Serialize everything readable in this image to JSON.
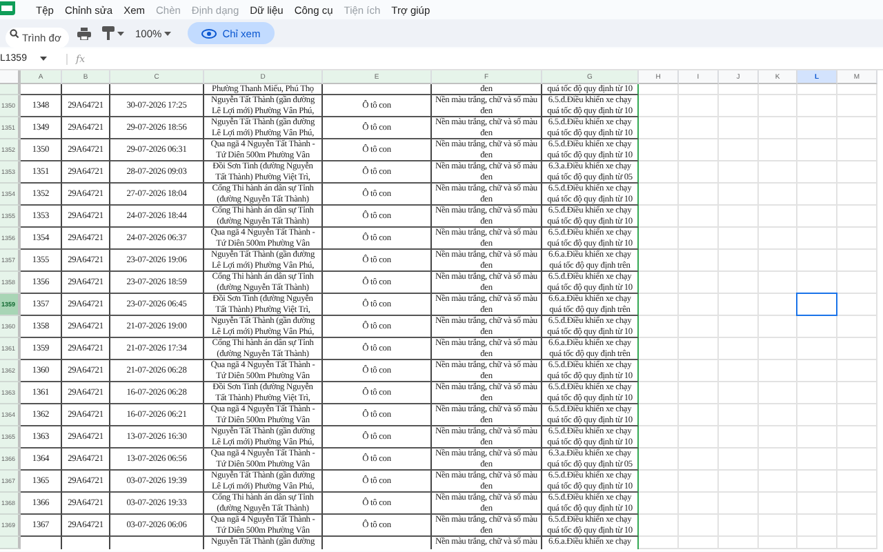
{
  "menu": [
    {
      "label": "Tệp",
      "disabled": false
    },
    {
      "label": "Chỉnh sửa",
      "disabled": false
    },
    {
      "label": "Xem",
      "disabled": false
    },
    {
      "label": "Chèn",
      "disabled": true
    },
    {
      "label": "Định dạng",
      "disabled": true
    },
    {
      "label": "Dữ liệu",
      "disabled": false
    },
    {
      "label": "Công cụ",
      "disabled": false
    },
    {
      "label": "Tiện ích",
      "disabled": true
    },
    {
      "label": "Trợ giúp",
      "disabled": false
    }
  ],
  "toolbar": {
    "search": {
      "placeholder": "Trình đơ"
    },
    "zoom": "100%",
    "view_mode": "Chỉ xem"
  },
  "formula_bar": {
    "name_box": "L1359",
    "fx": "fx"
  },
  "columns": [
    {
      "label": "A",
      "tinted": true,
      "selected": false
    },
    {
      "label": "B",
      "tinted": true,
      "selected": false
    },
    {
      "label": "C",
      "tinted": true,
      "selected": false
    },
    {
      "label": "D",
      "tinted": true,
      "selected": false
    },
    {
      "label": "E",
      "tinted": true,
      "selected": false
    },
    {
      "label": "F",
      "tinted": true,
      "selected": false
    },
    {
      "label": "G",
      "tinted": true,
      "selected": false
    },
    {
      "label": "H",
      "tinted": false,
      "selected": false
    },
    {
      "label": "I",
      "tinted": false,
      "selected": false
    },
    {
      "label": "J",
      "tinted": false,
      "selected": false
    },
    {
      "label": "K",
      "tinted": false,
      "selected": false
    },
    {
      "label": "L",
      "tinted": false,
      "selected": true
    },
    {
      "label": "M",
      "tinted": false,
      "selected": false
    }
  ],
  "top_partial_row": {
    "D": "Phường Thanh Miếu, Phú Thọ",
    "F": "đen",
    "G": "quá tốc độ quy định từ 10"
  },
  "rows": [
    {
      "header": "1350",
      "selected": false,
      "cells": [
        "1348",
        "29A64721",
        "30-07-2026 17:25",
        "Nguyễn Tất Thành (gần đường\nLê Lợi mới) Phường Vân Phú,",
        "Ô tô con",
        "Nền màu trắng, chữ và số màu\nđen",
        "6.5.đ.Điều khiển xe chạy\nquá tốc độ quy định từ 10"
      ]
    },
    {
      "header": "1351",
      "selected": false,
      "cells": [
        "1349",
        "29A64721",
        "29-07-2026 18:56",
        "Nguyễn Tất Thành (gần đường\nLê Lợi mới) Phường Vân Phú,",
        "Ô tô con",
        "Nền màu trắng, chữ và số màu\nđen",
        "6.5.đ.Điều khiển xe chạy\nquá tốc độ quy định từ 10"
      ]
    },
    {
      "header": "1352",
      "selected": false,
      "cells": [
        "1350",
        "29A64721",
        "29-07-2026 06:31",
        "Qua ngã 4 Nguyễn Tất Thành -\nTứ Diên 500m Phường Vân",
        "Ô tô con",
        "Nền màu trắng, chữ và số màu\nđen",
        "6.5.đ.Điều khiển xe chạy\nquá tốc độ quy định từ 10"
      ]
    },
    {
      "header": "1353",
      "selected": false,
      "cells": [
        "1351",
        "29A64721",
        "28-07-2026 09:03",
        "Đồi Sơn Tinh (đường Nguyễn\nTất Thành) Phường Việt Trì,",
        "Ô tô con",
        "Nền màu trắng, chữ và số màu\nđen",
        "6.3.a.Điều khiển xe chạy\nquá tốc độ quy định từ 05"
      ]
    },
    {
      "header": "1354",
      "selected": false,
      "cells": [
        "1352",
        "29A64721",
        "27-07-2026 18:04",
        "Cổng Thi hành án dân sự Tỉnh\n(đường Nguyễn Tất Thành)",
        "Ô tô con",
        "Nền màu trắng, chữ và số màu\nđen",
        "6.5.đ.Điều khiển xe chạy\nquá tốc độ quy định từ 10"
      ]
    },
    {
      "header": "1355",
      "selected": false,
      "cells": [
        "1353",
        "29A64721",
        "24-07-2026 18:44",
        "Cổng Thi hành án dân sự Tỉnh\n(đường Nguyễn Tất Thành)",
        "Ô tô con",
        "Nền màu trắng, chữ và số màu\nđen",
        "6.5.đ.Điều khiển xe chạy\nquá tốc độ quy định từ 10"
      ]
    },
    {
      "header": "1356",
      "selected": false,
      "cells": [
        "1354",
        "29A64721",
        "24-07-2026 06:37",
        "Qua ngã 4 Nguyễn Tất Thành -\nTứ Diên 500m Phường Vân",
        "Ô tô con",
        "Nền màu trắng, chữ và số màu\nđen",
        "6.5.đ.Điều khiển xe chạy\nquá tốc độ quy định từ 10"
      ]
    },
    {
      "header": "1357",
      "selected": false,
      "cells": [
        "1355",
        "29A64721",
        "23-07-2026 19:06",
        "Nguyễn Tất Thành (gần đường\nLê Lợi mới) Phường Vân Phú,",
        "Ô tô con",
        "Nền màu trắng, chữ và số màu\nđen",
        "6.6.a.Điều khiển xe chạy\nquá tốc độ quy định trên"
      ]
    },
    {
      "header": "1358",
      "selected": false,
      "cells": [
        "1356",
        "29A64721",
        "23-07-2026 18:59",
        "Cổng Thi hành án dân sự Tỉnh\n(đường Nguyễn Tất Thành)",
        "Ô tô con",
        "Nền màu trắng, chữ và số màu\nđen",
        "6.5.đ.Điều khiển xe chạy\nquá tốc độ quy định từ 10"
      ]
    },
    {
      "header": "1359",
      "selected": true,
      "cells": [
        "1357",
        "29A64721",
        "23-07-2026 06:45",
        "Đồi Sơn Tinh (đường Nguyễn\nTất Thành) Phường Việt Trì,",
        "Ô tô con",
        "Nền màu trắng, chữ và số màu\nđen",
        "6.6.a.Điều khiển xe chạy\nquá tốc độ quy định trên"
      ]
    },
    {
      "header": "1360",
      "selected": false,
      "cells": [
        "1358",
        "29A64721",
        "21-07-2026 19:00",
        "Nguyễn Tất Thành (gần đường\nLê Lợi mới) Phường Vân Phú,",
        "Ô tô con",
        "Nền màu trắng, chữ và số màu\nđen",
        "6.5.đ.Điều khiển xe chạy\nquá tốc độ quy định từ 10"
      ]
    },
    {
      "header": "1361",
      "selected": false,
      "cells": [
        "1359",
        "29A64721",
        "21-07-2026 17:34",
        "Cổng Thi hành án dân sự Tỉnh\n(đường Nguyễn Tất Thành)",
        "Ô tô con",
        "Nền màu trắng, chữ và số màu\nđen",
        "6.6.a.Điều khiển xe chạy\nquá tốc độ quy định trên"
      ]
    },
    {
      "header": "1362",
      "selected": false,
      "cells": [
        "1360",
        "29A64721",
        "21-07-2026 06:28",
        "Qua ngã 4 Nguyễn Tất Thành -\nTứ Diên 500m Phường Vân",
        "Ô tô con",
        "Nền màu trắng, chữ và số màu\nđen",
        "6.5.đ.Điều khiển xe chạy\nquá tốc độ quy định từ 10"
      ]
    },
    {
      "header": "1363",
      "selected": false,
      "cells": [
        "1361",
        "29A64721",
        "16-07-2026 06:28",
        "Đồi Sơn Tinh (đường Nguyễn\nTất Thành) Phường Việt Trì,",
        "Ô tô con",
        "Nền màu trắng, chữ và số màu\nđen",
        "6.5.đ.Điều khiển xe chạy\nquá tốc độ quy định từ 10"
      ]
    },
    {
      "header": "1364",
      "selected": false,
      "cells": [
        "1362",
        "29A64721",
        "16-07-2026 06:21",
        "Qua ngã 4 Nguyễn Tất Thành -\nTứ Diên 500m Phường Vân",
        "Ô tô con",
        "Nền màu trắng, chữ và số màu\nđen",
        "6.5.đ.Điều khiển xe chạy\nquá tốc độ quy định từ 10"
      ]
    },
    {
      "header": "1365",
      "selected": false,
      "cells": [
        "1363",
        "29A64721",
        "13-07-2026 16:30",
        "Nguyễn Tất Thành (gần đường\nLê Lợi mới) Phường Vân Phú,",
        "Ô tô con",
        "Nền màu trắng, chữ và số màu\nđen",
        "6.5.đ.Điều khiển xe chạy\nquá tốc độ quy định từ 10"
      ]
    },
    {
      "header": "1366",
      "selected": false,
      "cells": [
        "1364",
        "29A64721",
        "13-07-2026 06:56",
        "Qua ngã 4 Nguyễn Tất Thành -\nTứ Diên 500m Phường Vân",
        "Ô tô con",
        "Nền màu trắng, chữ và số màu\nđen",
        "6.3.a.Điều khiển xe chạy\nquá tốc độ quy định từ 05"
      ]
    },
    {
      "header": "1367",
      "selected": false,
      "cells": [
        "1365",
        "29A64721",
        "03-07-2026 19:39",
        "Nguyễn Tất Thành (gần đường\nLê Lợi mới) Phường Vân Phú,",
        "Ô tô con",
        "Nền màu trắng, chữ và số màu\nđen",
        "6.5.đ.Điều khiển xe chạy\nquá tốc độ quy định từ 10"
      ]
    },
    {
      "header": "1368",
      "selected": false,
      "cells": [
        "1366",
        "29A64721",
        "03-07-2026 19:33",
        "Cổng Thi hành án dân sự Tỉnh\n(đường Nguyễn Tất Thành)",
        "Ô tô con",
        "Nền màu trắng, chữ và số màu\nđen",
        "6.5.đ.Điều khiển xe chạy\nquá tốc độ quy định từ 10"
      ]
    },
    {
      "header": "1369",
      "selected": false,
      "cells": [
        "1367",
        "29A64721",
        "03-07-2026 06:06",
        "Qua ngã 4 Nguyễn Tất Thành -\nTứ Diên 500m Phường Vân",
        "Ô tô con",
        "Nền màu trắng, chữ và số màu\nđen",
        "6.5.đ.Điều khiển xe chạy\nquá tốc độ quy định từ 10"
      ]
    }
  ],
  "bottom_partial_row": {
    "D": "Nguyễn Tất Thành (gần đường",
    "F": "Nền màu trắng, chữ và số màu",
    "G": "6.6.a.Điều khiển xe chạy"
  }
}
